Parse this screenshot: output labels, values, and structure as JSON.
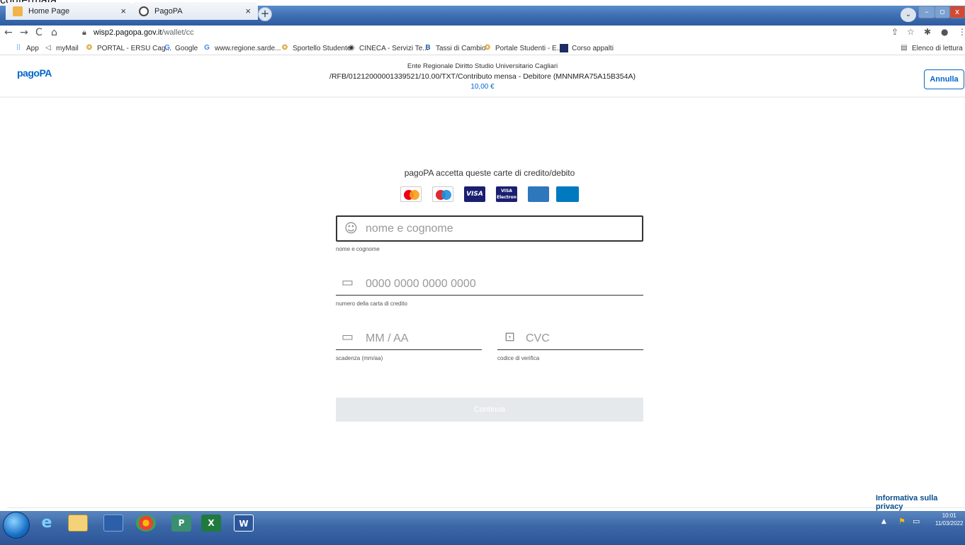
{
  "cropped_top_text": "confermata.",
  "browser": {
    "tabs": [
      {
        "label": "Home Page",
        "close": "×"
      },
      {
        "label": "PagoPA",
        "close": "×"
      }
    ],
    "new_tab": "+",
    "url_host": "wisp2.pagopa.gov.it",
    "url_path": "/wallet/cc",
    "bookmarks": [
      {
        "label": "App",
        "icon": "apps-grid-icon"
      },
      {
        "label": "myMail",
        "icon": "mail-icon"
      },
      {
        "label": "PORTAL - ERSU Cag...",
        "icon": "ersu-icon"
      },
      {
        "label": "Google",
        "icon": "google-icon"
      },
      {
        "label": "www.regione.sarde...",
        "icon": "google-icon"
      },
      {
        "label": "Sportello Studente",
        "icon": "ersu-icon"
      },
      {
        "label": "CINECA - Servizi Te...",
        "icon": "globe-icon"
      },
      {
        "label": "Tassi di Cambio",
        "icon": "ib-icon"
      },
      {
        "label": "Portale Studenti - E...",
        "icon": "ersu-icon"
      },
      {
        "label": "Corso appalti",
        "icon": "book-icon"
      }
    ],
    "reading_list": "Elenco di lettura"
  },
  "header": {
    "logo": "pagoPA",
    "line1": "Ente Regionale Diritto Studio Universitario Cagliari",
    "line2": "/RFB/01212000001339521/10.00/TXT/Contributo mensa - Debitore (MNNMRA75A15B354A)",
    "amount": "10,00 €",
    "cancel": "Annulla"
  },
  "form": {
    "accept_text": "pagoPA accetta queste carte di credito/debito",
    "name": {
      "placeholder": "nome e cognome",
      "label": "nome e cognome"
    },
    "card_number": {
      "placeholder": "0000 0000 0000 0000",
      "label": "numero della carta di credito"
    },
    "expiry": {
      "placeholder": "MM / AA",
      "label": "scadenza (mm/aa)"
    },
    "cvc": {
      "placeholder": "CVC",
      "label": "codice di verifica"
    },
    "submit": "Continua"
  },
  "footer": {
    "privacy": "Informativa sulla privacy"
  },
  "taskbar": {
    "time": "10:01",
    "date": "11/03/2022"
  }
}
